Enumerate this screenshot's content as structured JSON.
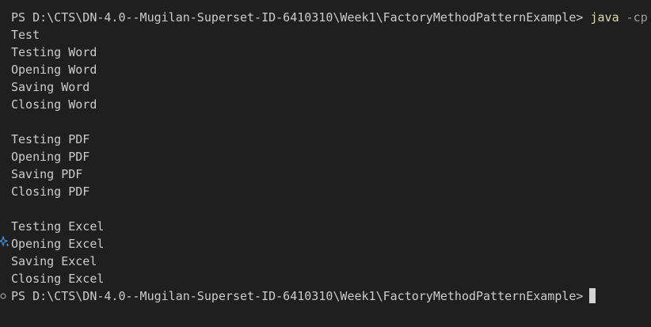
{
  "terminal": {
    "prompt_line": {
      "prompt": "PS D:\\CTS\\DN-4.0--Mugilan-Superset-ID-6410310\\Week1\\FactoryMethodPatternExample>",
      "command": "java",
      "args": "-cp"
    },
    "output": [
      "Test",
      "Testing Word",
      "Opening Word",
      "Saving Word",
      "Closing Word",
      "",
      "Testing PDF",
      "Opening PDF",
      "Saving PDF",
      "Closing PDF",
      "",
      "Testing Excel",
      "Opening Excel",
      "Saving Excel",
      "Closing Excel"
    ],
    "final_prompt": "PS D:\\CTS\\DN-4.0--Mugilan-Superset-ID-6410310\\Week1\\FactoryMethodPatternExample>",
    "icons": {
      "sparkle": "sparkle-icon",
      "circle": "circle-icon",
      "cursor": "cursor-block"
    },
    "colors": {
      "background": "#1f1f1f",
      "text": "#cccccc",
      "command": "#dcdcaa",
      "argument": "#9d9d9d"
    }
  }
}
